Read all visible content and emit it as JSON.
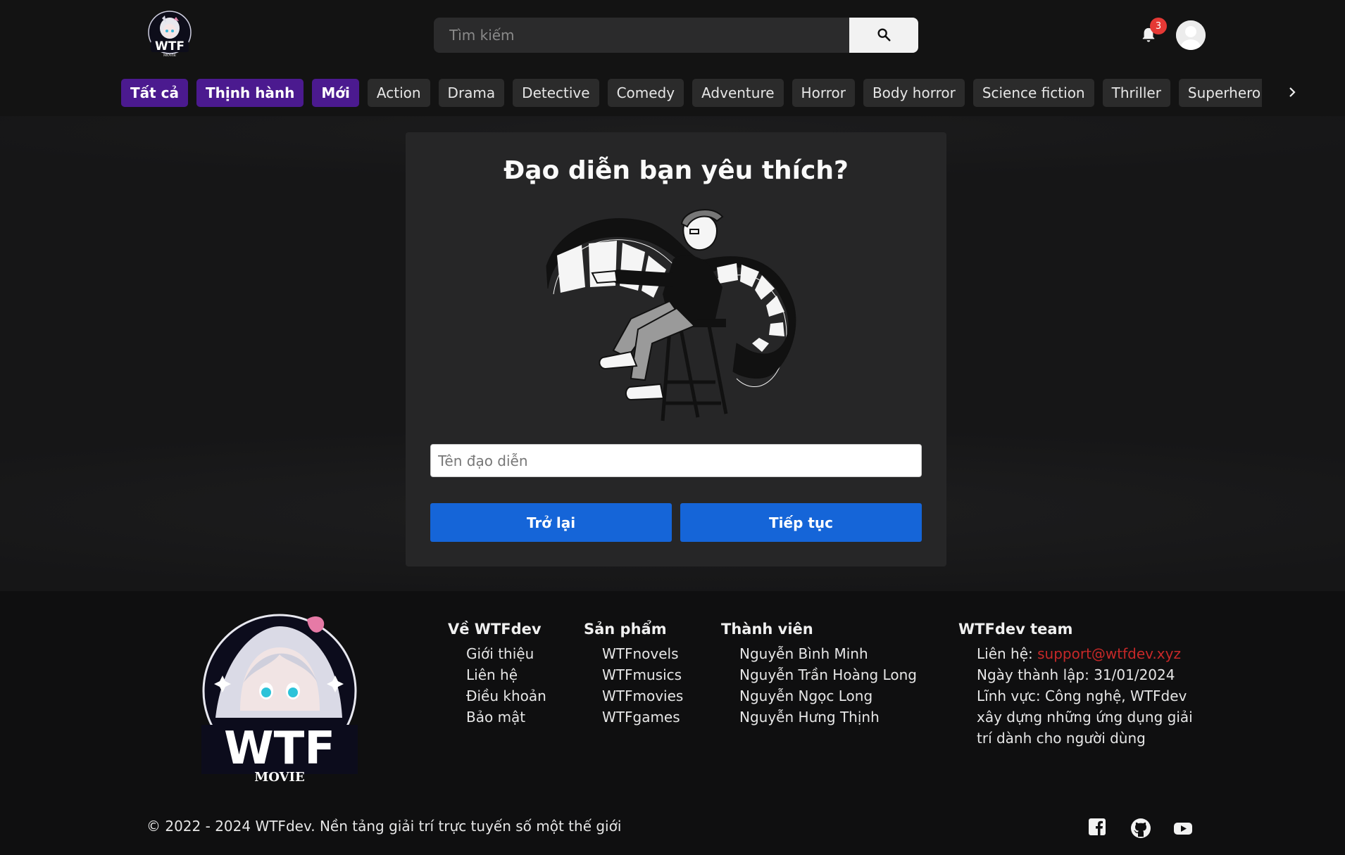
{
  "header": {
    "logo_text": "WTF",
    "logo_sub": "MOVIE",
    "search_placeholder": "Tìm kiếm",
    "notification_count": "3"
  },
  "categories": [
    {
      "label": "Tất cả",
      "highlight": true
    },
    {
      "label": "Thịnh hành",
      "highlight": true
    },
    {
      "label": "Mới",
      "highlight": true
    },
    {
      "label": "Action",
      "highlight": false
    },
    {
      "label": "Drama",
      "highlight": false
    },
    {
      "label": "Detective",
      "highlight": false
    },
    {
      "label": "Comedy",
      "highlight": false
    },
    {
      "label": "Adventure",
      "highlight": false
    },
    {
      "label": "Horror",
      "highlight": false
    },
    {
      "label": "Body horror",
      "highlight": false
    },
    {
      "label": "Science fiction",
      "highlight": false
    },
    {
      "label": "Thriller",
      "highlight": false
    },
    {
      "label": "Superhero",
      "highlight": false
    }
  ],
  "card": {
    "title": "Đạo diễn bạn yêu thích?",
    "input_placeholder": "Tên đạo diễn",
    "back_label": "Trở lại",
    "next_label": "Tiếp tục"
  },
  "footer": {
    "logo_text": "WTF",
    "logo_sub": "MOVIE",
    "columns": [
      {
        "title": "Về WTFdev",
        "items": [
          "Giới thiệu",
          "Liên hệ",
          "Điều khoản",
          "Bảo mật"
        ]
      },
      {
        "title": "Sản phẩm",
        "items": [
          "WTFnovels",
          "WTFmusics",
          "WTFmovies",
          "WTFgames"
        ]
      },
      {
        "title": "Thành viên",
        "items": [
          "Nguyễn Bình Minh",
          "Nguyễn Trần Hoàng Long",
          "Nguyễn Ngọc Long",
          "Nguyễn Hưng Thịnh"
        ]
      }
    ],
    "team": {
      "title": "WTFdev team",
      "contact_label": "Liên hệ: ",
      "email": "support@wtfdev.xyz",
      "founded": "Ngày thành lập: 31/01/2024",
      "field_line1": "Lĩnh vực: Công nghệ, WTFdev",
      "field_line2": "xây dựng những ứng dụng giải",
      "field_line3": "trí dành cho người dùng"
    },
    "copyright": "© 2022 - 2024 WTFdev. Nền tảng giải trí trực tuyến số một thế giới",
    "social": [
      "facebook-icon",
      "github-icon",
      "youtube-icon"
    ]
  },
  "colors": {
    "accent_chip": "#4b1a8f",
    "button": "#1565d8",
    "email": "#c62828",
    "badge": "#e53935"
  }
}
